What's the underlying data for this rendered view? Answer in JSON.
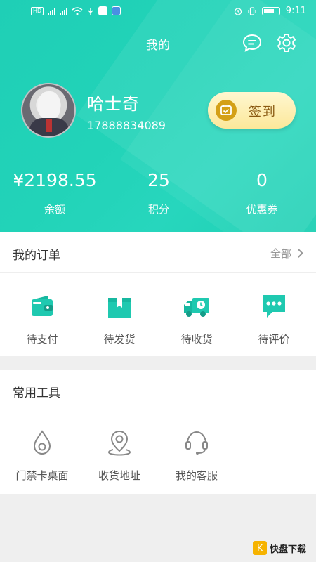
{
  "status_bar": {
    "time": "9:11",
    "left_icons": [
      "hd-icon",
      "signal-icon",
      "signal-icon",
      "wifi-icon",
      "usb-icon",
      "app-icon",
      "app-icon"
    ],
    "right_icons": [
      "alarm-icon",
      "vibrate-icon",
      "battery-icon"
    ]
  },
  "header": {
    "title": "我的",
    "colors": {
      "primary": "#22d3b8",
      "signin_bg": "#fce89a",
      "signin_text": "#8a5a12"
    }
  },
  "profile": {
    "name": "哈士奇",
    "phone": "17888834089",
    "signin_label": "签到"
  },
  "stats": [
    {
      "value": "¥2198.55",
      "label": "余额"
    },
    {
      "value": "25",
      "label": "积分"
    },
    {
      "value": "0",
      "label": "优惠券"
    }
  ],
  "orders": {
    "title": "我的订单",
    "more": "全部",
    "items": [
      {
        "label": "待支付",
        "icon": "wallet-icon"
      },
      {
        "label": "待发货",
        "icon": "box-icon"
      },
      {
        "label": "待收货",
        "icon": "truck-icon"
      },
      {
        "label": "待评价",
        "icon": "comment-icon"
      }
    ]
  },
  "tools": {
    "title": "常用工具",
    "items": [
      {
        "label": "门禁卡桌面",
        "icon": "card-drop-icon"
      },
      {
        "label": "收货地址",
        "icon": "location-icon"
      },
      {
        "label": "我的客服",
        "icon": "headset-icon"
      }
    ]
  },
  "watermark": {
    "text": "快盘下载"
  }
}
